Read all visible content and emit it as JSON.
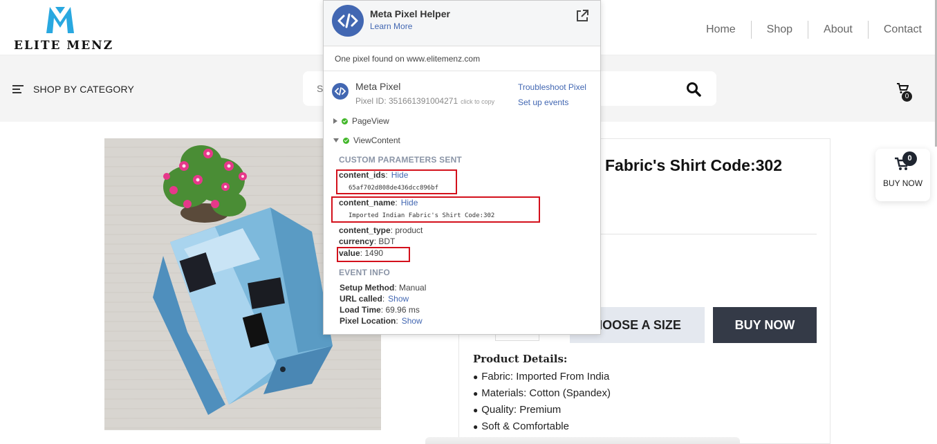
{
  "brand": {
    "name": "ELITE MENZ",
    "accent": "#29a8e0"
  },
  "nav": {
    "items": [
      "Home",
      "Shop",
      "About",
      "Contact"
    ]
  },
  "category_bar": {
    "label": "SHOP BY CATEGORY"
  },
  "search": {
    "placeholder": "S",
    "icon": "search-icon"
  },
  "header_cart": {
    "count": "0"
  },
  "product": {
    "title": "Fabric's Shirt Code:302",
    "size_button": "HOOSE A SIZE",
    "buy_button": "BUY NOW",
    "details_heading": "Product Details:",
    "details": [
      "Fabric: Imported From India",
      "Materials: Cotton (Spandex)",
      "Quality: Premium",
      "Soft & Comfortable"
    ]
  },
  "floating_cart": {
    "count": "0",
    "label": "BUY NOW"
  },
  "pixel_helper": {
    "title": "Meta Pixel Helper",
    "learn_more": "Learn More",
    "found_text": "One pixel found on www.elitemenz.com",
    "pixel_name": "Meta Pixel",
    "pixel_id": "Pixel ID: 351661391004271",
    "click_to_copy": "click to copy",
    "troubleshoot": "Troubleshoot Pixel",
    "setup_events": "Set up events",
    "events": [
      "PageView",
      "ViewContent"
    ],
    "custom_params_heading": "CUSTOM PARAMETERS SENT",
    "params": {
      "content_ids": {
        "key": "content_ids",
        "action": "Hide",
        "value": "65af702d808de436dcc896bf"
      },
      "content_name": {
        "key": "content_name",
        "action": "Hide",
        "value": "Imported Indian Fabric's Shirt Code:302"
      },
      "content_type": {
        "key": "content_type",
        "value": ": product"
      },
      "currency": {
        "key": "currency",
        "value": ": BDT"
      },
      "value": {
        "key": "value",
        "value": ": 1490"
      }
    },
    "event_info_heading": "EVENT INFO",
    "event_info": {
      "setup_method": {
        "key": "Setup Method",
        "value": ": Manual"
      },
      "url_called": {
        "key": "URL called",
        "action": "Show",
        "sep": ":"
      },
      "load_time": {
        "key": "Load Time",
        "value": ": 69.96 ms"
      },
      "pixel_location": {
        "key": "Pixel Location",
        "action": "Show",
        "sep": ":"
      }
    },
    "colors": {
      "brand_blue": "#4267b2",
      "success": "#42b72a",
      "highlight": "#d3101b"
    }
  }
}
